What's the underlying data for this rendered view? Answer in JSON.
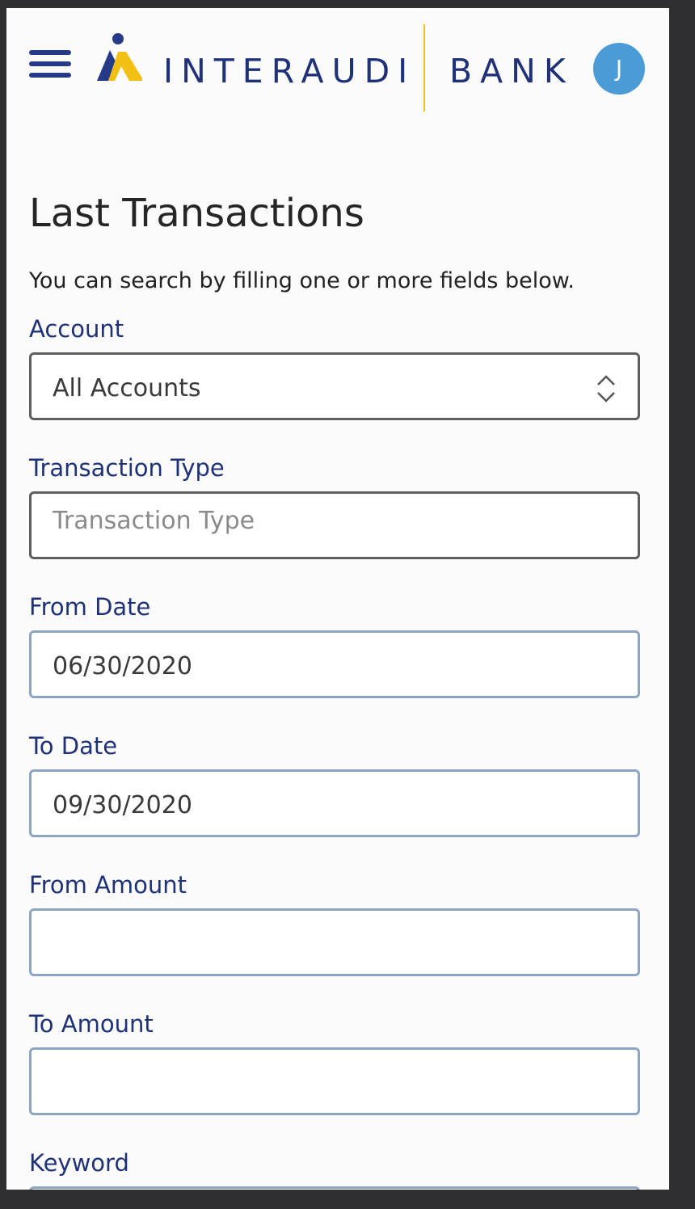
{
  "header": {
    "brand_left": "INTERAUDI",
    "brand_right": "BANK",
    "avatar_initial": "J"
  },
  "page": {
    "title": "Last Transactions",
    "intro": "You can search by filling one or more fields below."
  },
  "form": {
    "account": {
      "label": "Account",
      "value": "All Accounts"
    },
    "transaction_type": {
      "label": "Transaction Type",
      "placeholder": "Transaction Type",
      "value": ""
    },
    "from_date": {
      "label": "From Date",
      "value": "06/30/2020"
    },
    "to_date": {
      "label": "To Date",
      "value": "09/30/2020"
    },
    "from_amount": {
      "label": "From Amount",
      "value": ""
    },
    "to_amount": {
      "label": "To Amount",
      "value": ""
    },
    "keyword": {
      "label": "Keyword",
      "value": ""
    }
  },
  "colors": {
    "brand_navy": "#1f3278",
    "brand_yellow": "#f2c013",
    "avatar_blue": "#4b9bd6"
  },
  "icons": {
    "menu": "hamburger-menu-icon",
    "logo": "interaudi-logo-mark",
    "select": "up-down-chevron-icon"
  }
}
